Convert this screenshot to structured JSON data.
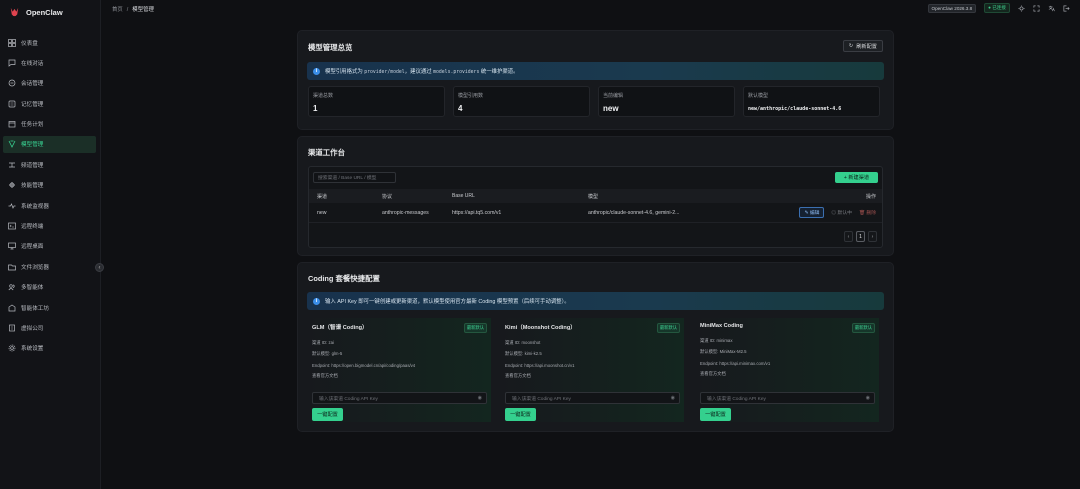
{
  "app": {
    "name": "OpenClaw"
  },
  "breadcrumb": {
    "home": "首页",
    "sep": "/",
    "current": "模型管理"
  },
  "topbar": {
    "version": "OpenClaw 2026.3.8",
    "status": "● 已连接"
  },
  "sidebar": {
    "items": [
      {
        "label": "仪表盘",
        "icon": "grid-icon"
      },
      {
        "label": "在线对话",
        "icon": "chat-icon"
      },
      {
        "label": "会话管理",
        "icon": "session-icon"
      },
      {
        "label": "记忆管理",
        "icon": "memory-icon"
      },
      {
        "label": "任务计划",
        "icon": "calendar-icon"
      },
      {
        "label": "模型管理",
        "icon": "model-icon",
        "active": true
      },
      {
        "label": "频道管理",
        "icon": "channel-icon"
      },
      {
        "label": "技能管理",
        "icon": "skill-icon"
      },
      {
        "label": "系统监视器",
        "icon": "pulse-icon"
      },
      {
        "label": "远程终端",
        "icon": "terminal-icon"
      },
      {
        "label": "远程桌面",
        "icon": "desktop-icon"
      },
      {
        "label": "文件浏览器",
        "icon": "folder-icon"
      },
      {
        "label": "多智能体",
        "icon": "users-icon"
      },
      {
        "label": "智能体工坊",
        "icon": "workshop-icon"
      },
      {
        "label": "虚拟公司",
        "icon": "company-icon"
      },
      {
        "label": "系统设置",
        "icon": "settings-icon"
      }
    ]
  },
  "overview": {
    "title": "模型管理总览",
    "refresh": "刷新配置",
    "info_prefix": "模型引用格式为 ",
    "info_code1": "provider/model",
    "info_mid": "，建议通过 ",
    "info_code2": "models.providers",
    "info_suffix": " 统一维护渠道。",
    "stats": [
      {
        "label": "渠道总数",
        "value": "1"
      },
      {
        "label": "模型引用数",
        "value": "4"
      },
      {
        "label": "当前编辑",
        "value": "new"
      },
      {
        "label": "默认模型",
        "value": "new/anthropic/claude-sonnet-4.6"
      }
    ]
  },
  "workspace": {
    "title": "渠道工作台",
    "search_placeholder": "搜索渠道 / Base URL / 模型",
    "new_btn": "+ 新建渠道",
    "columns": [
      "渠道",
      "协议",
      "Base URL",
      "模型",
      "操作"
    ],
    "rows": [
      {
        "channel": "new",
        "protocol": "anthropic-messages",
        "base_url": "https://api.tq5.com/v1",
        "models": "anthropic/claude-sonnet-4.6, gemini-2...",
        "edit": "编辑",
        "disable": "◎ 默认中",
        "delete": "删除"
      }
    ],
    "pager": {
      "prev": "‹",
      "page": "1",
      "next": "›"
    }
  },
  "coding": {
    "title": "Coding 套餐快捷配置",
    "info": "输入 API Key 即可一键创建或更新渠道，默认模型使用官方最新 Coding 模型预置（后续可手动调整）。",
    "cards": [
      {
        "name": "GLM（智谱 Coding）",
        "badge": "最新默认",
        "channel_id": "渠道 ID: zai",
        "default_model": "默认模型: glm-5",
        "endpoint": "Endpoint: https://open.bigmodel.cn/api/coding/paas/v4",
        "docs": "查看官方文档",
        "placeholder": "输入该渠道 Coding API Key",
        "apply": "一键配置"
      },
      {
        "name": "Kimi（Moonshot Coding）",
        "badge": "最新默认",
        "channel_id": "渠道 ID: moonshot",
        "default_model": "默认模型: kimi-k2.5",
        "endpoint": "Endpoint: https://api.moonshot.cn/v1",
        "docs": "查看官方文档",
        "placeholder": "输入该渠道 Coding API Key",
        "apply": "一键配置"
      },
      {
        "name": "MiniMax Coding",
        "badge": "最新默认",
        "channel_id": "渠道 ID: minimax",
        "default_model": "默认模型: MiniMax-M2.5",
        "endpoint": "Endpoint: https://api.minimax.com/v1",
        "docs": "查看官方文档",
        "placeholder": "输入该渠道 Coding API Key",
        "apply": "一键配置"
      }
    ]
  },
  "colors": {
    "accent": "#34d08e",
    "info": "#3b8ee8",
    "bg": "#0f1013",
    "card": "#17191d"
  }
}
